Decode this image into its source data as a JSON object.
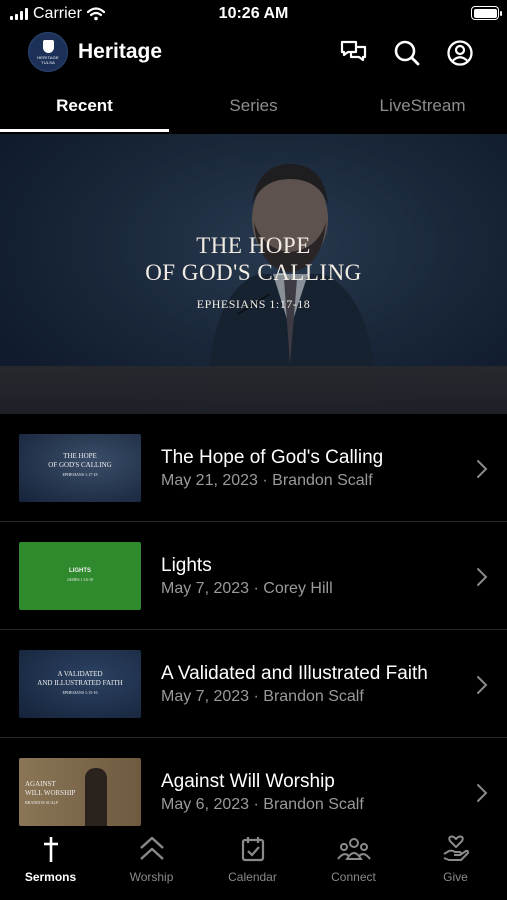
{
  "status_bar": {
    "carrier": "Carrier",
    "time": "10:26 AM"
  },
  "header": {
    "title": "Heritage",
    "logo_text_1": "HERITAGE",
    "logo_text_2": "TULSA",
    "icons": [
      "chat-icon",
      "search-icon",
      "profile-icon"
    ]
  },
  "tabs": [
    {
      "label": "Recent",
      "active": true
    },
    {
      "label": "Series",
      "active": false
    },
    {
      "label": "LiveStream",
      "active": false
    }
  ],
  "hero": {
    "title_line1": "THE HOPE",
    "title_line2": "OF GOD'S CALLING",
    "subtitle": "EPHESIANS 1:17-18"
  },
  "sermons": [
    {
      "title": "The Hope of God's Calling",
      "meta": "May 21, 2023 · Brandon Scalf",
      "thumb_line1": "THE HOPE",
      "thumb_line2": "OF GOD'S CALLING",
      "thumb_line3": "EPHESIANS 1:17-18"
    },
    {
      "title": "Lights",
      "meta": "May 7, 2023 · Corey Hill",
      "thumb_line1": "LIGHTS",
      "thumb_line2": "JAMES 1:16-18"
    },
    {
      "title": "A Validated and Illustrated Faith",
      "meta": "May 7, 2023 · Brandon Scalf",
      "thumb_line1": "A VALIDATED",
      "thumb_line2": "AND ILLUSTRATED FAITH",
      "thumb_line3": "EPHESIANS 1:15-16"
    },
    {
      "title": "Against Will Worship",
      "meta": "May 6, 2023 · Brandon Scalf",
      "thumb_line1": "AGAINST",
      "thumb_line2": "WILL WORSHIP",
      "thumb_line3": "BRANDON SCALF"
    }
  ],
  "bottom_nav": [
    {
      "label": "Sermons",
      "active": true
    },
    {
      "label": "Worship",
      "active": false
    },
    {
      "label": "Calendar",
      "active": false
    },
    {
      "label": "Connect",
      "active": false
    },
    {
      "label": "Give",
      "active": false
    }
  ],
  "colors": {
    "background": "#000000",
    "inactive": "#8e8e8e",
    "meta": "#9a9a9a",
    "lights_green": "#2f8a2d"
  }
}
